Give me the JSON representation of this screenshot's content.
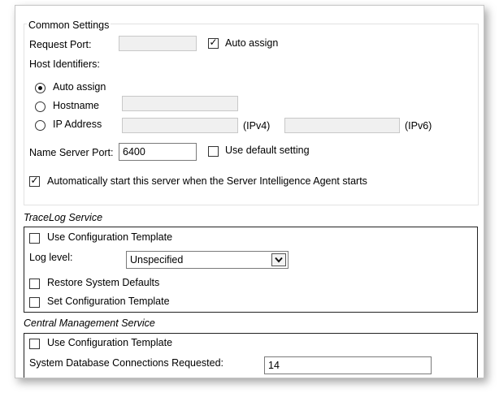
{
  "common": {
    "title": "Common Settings",
    "request_port_label": "Request Port:",
    "request_port_value": "",
    "auto_assign_port_label": "Auto assign",
    "host_identifiers_label": "Host Identifiers:",
    "radio_auto_assign": "Auto assign",
    "radio_hostname": "Hostname",
    "radio_ip": "IP Address",
    "ipv4_label": "(IPv4)",
    "ipv6_label": "(IPv6)",
    "name_server_port_label": "Name Server Port:",
    "name_server_port_value": "6400",
    "use_default_setting_label": "Use default setting",
    "auto_start_label": "Automatically start this server when the Server Intelligence Agent starts"
  },
  "tracelog": {
    "title": "TraceLog Service",
    "use_config_template_label": "Use Configuration Template",
    "log_level_label": "Log level:",
    "log_level_value": "Unspecified",
    "restore_defaults_label": "Restore System Defaults",
    "set_config_template_label": "Set Configuration Template"
  },
  "cms": {
    "title": "Central Management Service",
    "use_config_template_label": "Use Configuration Template",
    "db_connections_label": "System Database Connections Requested:",
    "db_connections_value": "14"
  },
  "state": {
    "auto_assign_port_checked": true,
    "host_identifier_selected": "auto_assign",
    "use_default_setting_checked": false,
    "auto_start_checked": true,
    "tracelog_use_template_checked": false,
    "restore_defaults_checked": false,
    "set_template_checked": false,
    "cms_use_template_checked": false
  },
  "icons": {
    "checkmark": "check-icon",
    "dropdown": "chevron-down-icon"
  }
}
